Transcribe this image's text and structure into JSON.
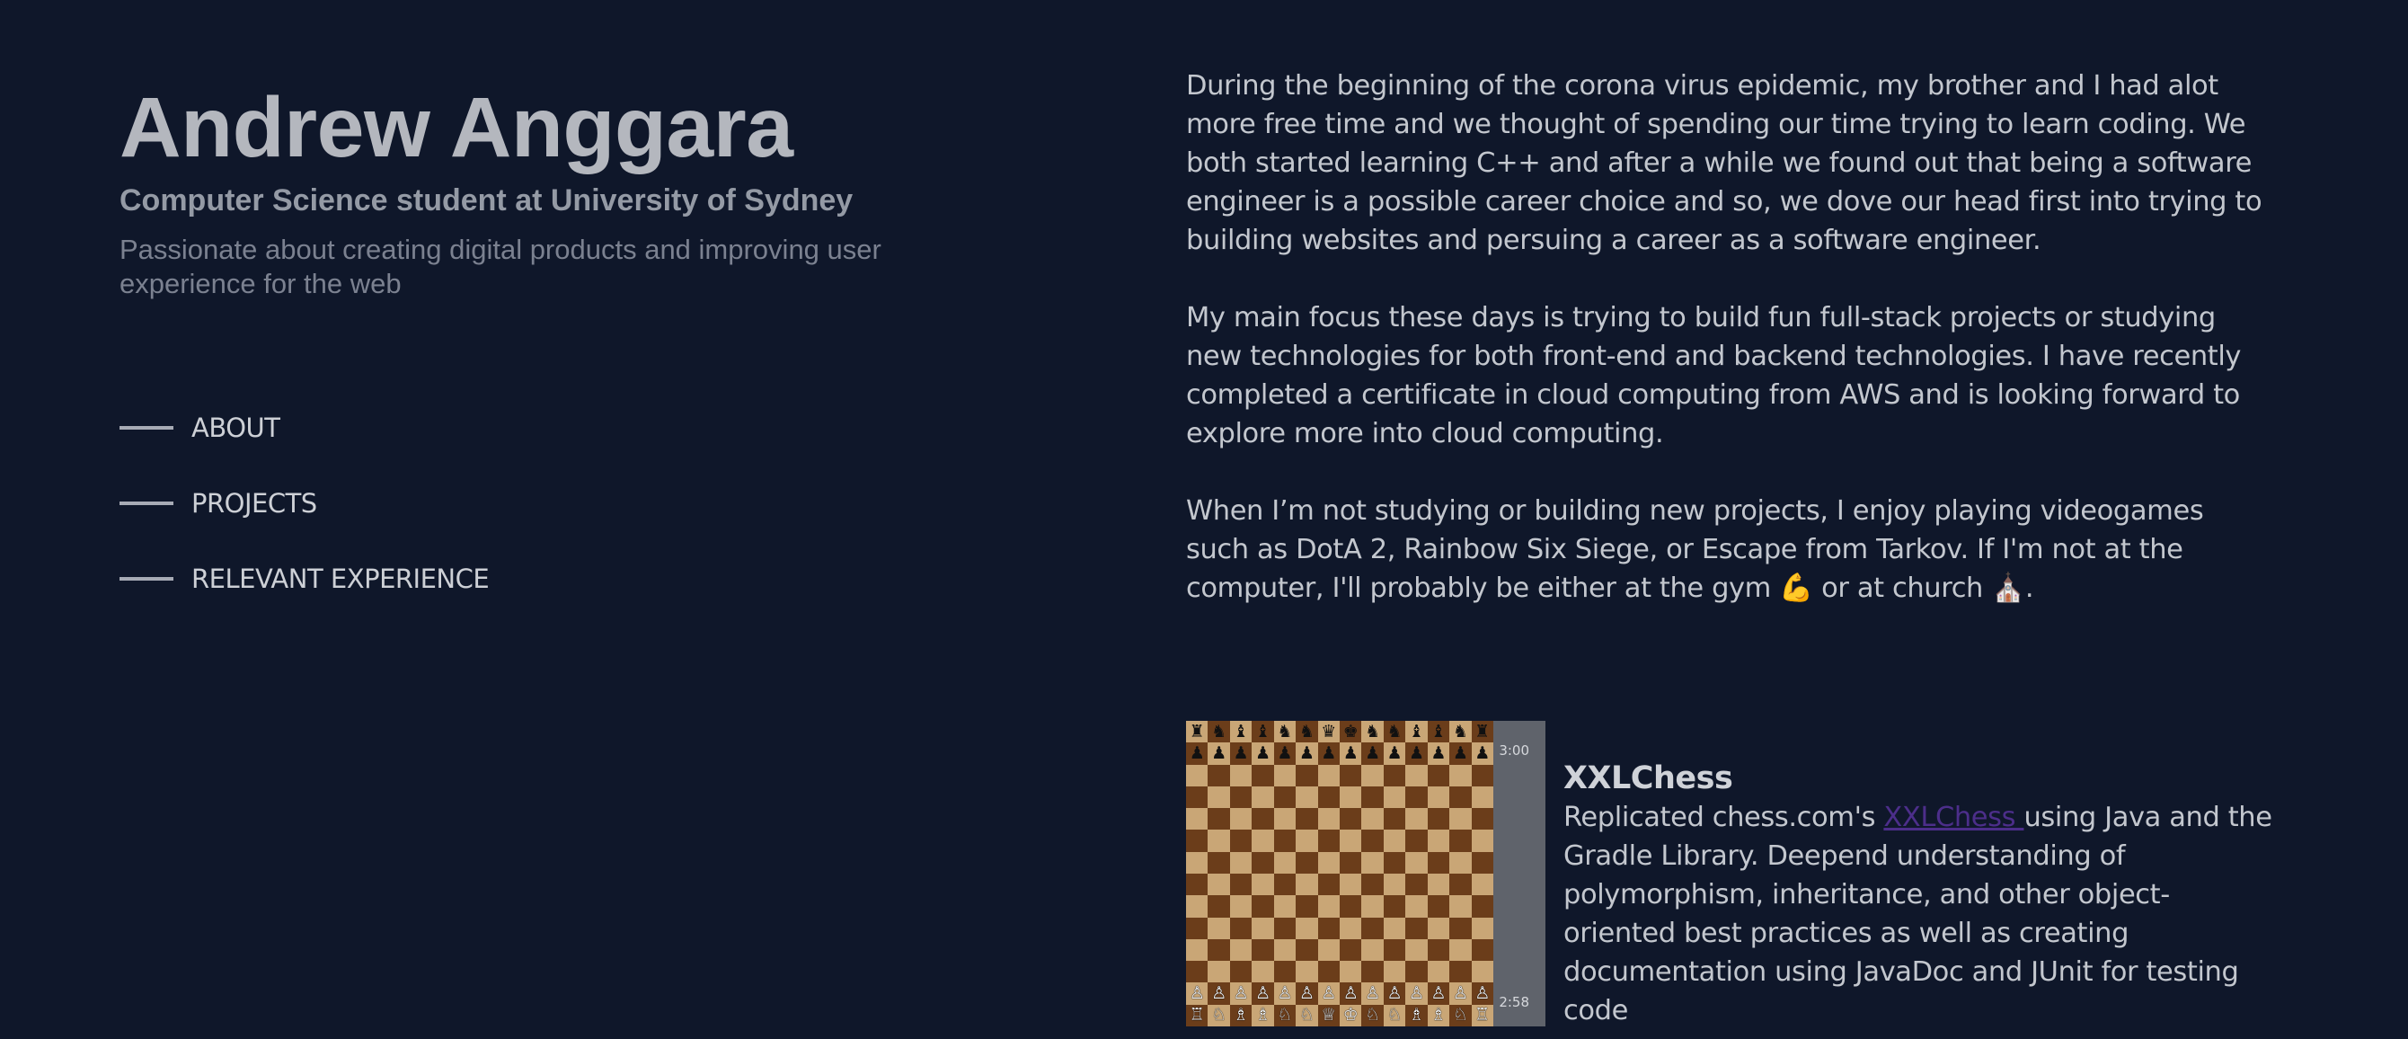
{
  "header": {
    "name": "Andrew Anggara",
    "subtitle": "Computer Science student at University of Sydney",
    "tagline": "Passionate about creating digital products and improving user experience for the web"
  },
  "nav": {
    "items": [
      {
        "label": "ABOUT"
      },
      {
        "label": "PROJECTS"
      },
      {
        "label": "RELEVANT EXPERIENCE"
      }
    ]
  },
  "about": {
    "paragraphs": [
      "During the beginning of the corona virus epidemic, my brother and I had alot more free time and we thought of spending our time trying to learn coding. We both started learning C++ and after a while we found out that being a software engineer is a possible career choice and so, we dove our head first into trying to building websites and persuing a career as a software engineer.",
      "My main focus these days is trying to build fun full-stack projects or studying new technologies for both front-end and backend technologies. I have recently completed a certificate in cloud computing from AWS and is looking forward to explore more into cloud computing.",
      "When I’m not studying or building new projects, I enjoy playing videogames such as DotA 2, Rainbow Six Siege, or Escape from Tarkov. If I'm not at the computer, I'll probably be either at the gym 💪 or at church ⛪."
    ]
  },
  "projects": [
    {
      "title": "XXLChess",
      "desc_before": "Replicated chess.com's ",
      "link_text": "XXLChess ",
      "desc_after": "using Java and the Gradle Library. Deepend understanding of polymorphism, inheritance, and other object-oriented best practices as well as creating documentation using JavaDoc and JUnit for testing code",
      "image": {
        "top_clock": "3:00",
        "bottom_clock": "2:58",
        "board_size": 14,
        "black_back_rank": [
          "♜",
          "♞",
          "♝",
          "♝",
          "♞",
          "♞",
          "♛",
          "♚",
          "♞",
          "♞",
          "♝",
          "♝",
          "♞",
          "♜"
        ],
        "white_back_rank": [
          "♖",
          "♘",
          "♗",
          "♗",
          "♘",
          "♘",
          "♕",
          "♔",
          "♘",
          "♘",
          "♗",
          "♗",
          "♘",
          "♖"
        ],
        "black_pawn": "♟",
        "white_pawn": "♙",
        "colors": {
          "light": "#c9a676",
          "dark": "#6b3d1a",
          "panel": "#5f636b"
        }
      }
    }
  ],
  "colors": {
    "background": "#0f172a",
    "link": "#4c2e8a"
  }
}
